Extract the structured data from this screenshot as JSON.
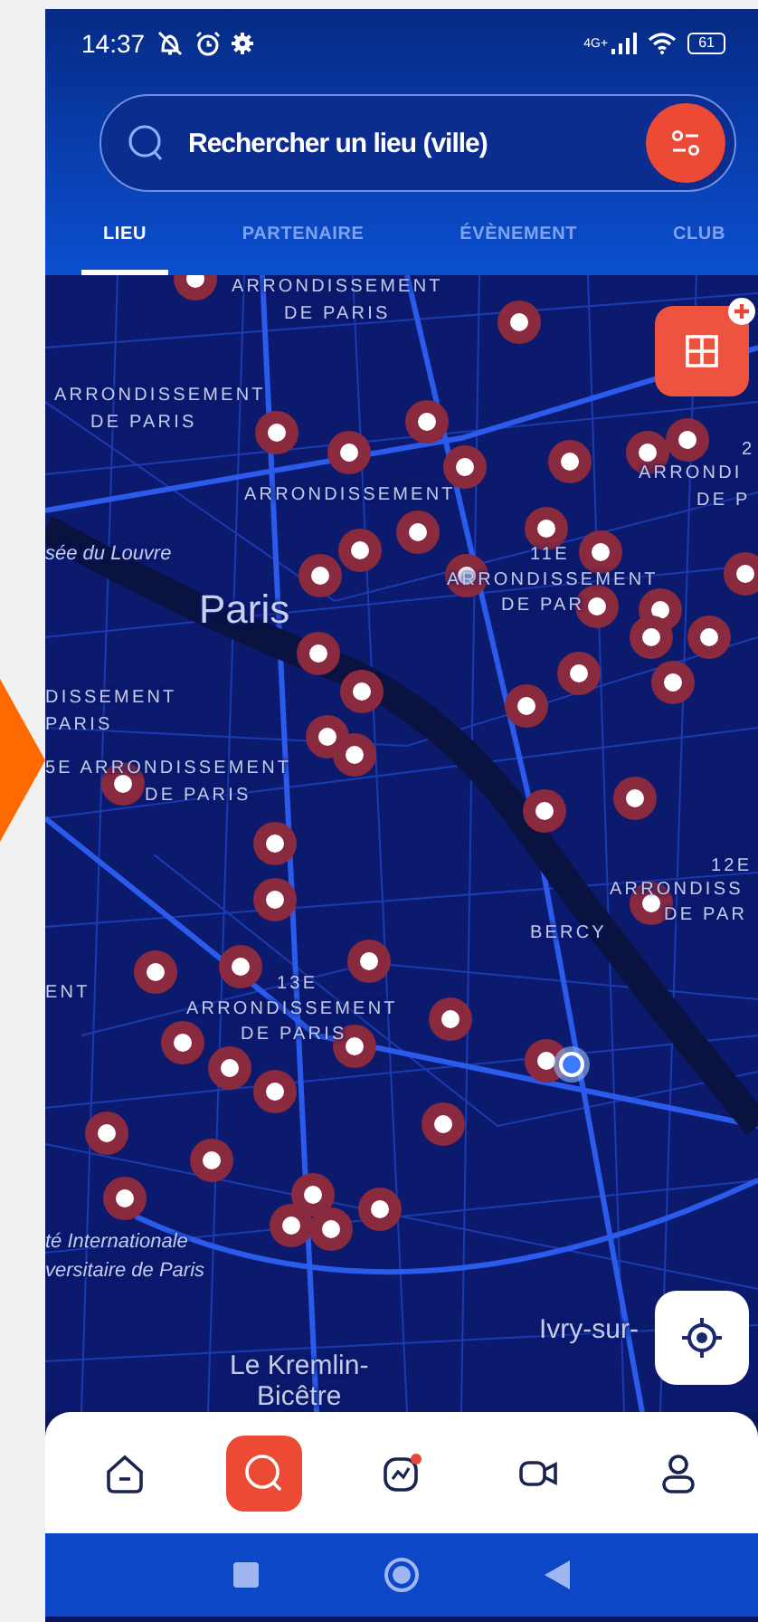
{
  "status_bar": {
    "time": "14:37",
    "network": "4G+",
    "battery": "61"
  },
  "search": {
    "placeholder": "Rechercher un lieu (ville)"
  },
  "tabs": [
    {
      "label": "LIEU",
      "selected": true
    },
    {
      "label": "PARTENAIRE",
      "selected": false
    },
    {
      "label": "ÉVÈNEMENT",
      "selected": false
    },
    {
      "label": "CLUB",
      "selected": false
    }
  ],
  "map": {
    "labels": [
      {
        "text": "ARRONDISSEMENT",
        "kind": "district"
      },
      {
        "text": "DE PARIS",
        "kind": "district"
      },
      {
        "text": "ARRONDISSEMENT",
        "kind": "district"
      },
      {
        "text": "DE PARIS",
        "kind": "district"
      },
      {
        "text": "ARRONDISSEMENT",
        "kind": "district"
      },
      {
        "text": "2",
        "kind": "district"
      },
      {
        "text": "ARRONDI",
        "kind": "district"
      },
      {
        "text": "DE P",
        "kind": "district"
      },
      {
        "text": "sée du Louvre",
        "kind": "poi"
      },
      {
        "text": "Paris",
        "kind": "city"
      },
      {
        "text": "11E",
        "kind": "district"
      },
      {
        "text": "ARRONDISSEMENT",
        "kind": "district"
      },
      {
        "text": "DE PAR",
        "kind": "district"
      },
      {
        "text": "DISSEMENT",
        "kind": "district"
      },
      {
        "text": "PARIS",
        "kind": "district"
      },
      {
        "text": "5E ARRONDISSEMENT",
        "kind": "district"
      },
      {
        "text": "DE PARIS",
        "kind": "district"
      },
      {
        "text": "12E",
        "kind": "district"
      },
      {
        "text": "ARRONDISS",
        "kind": "district"
      },
      {
        "text": "DE PAR",
        "kind": "district"
      },
      {
        "text": "BERCY",
        "kind": "district"
      },
      {
        "text": "ENT",
        "kind": "district"
      },
      {
        "text": "13E",
        "kind": "district"
      },
      {
        "text": "ARRONDISSEMENT",
        "kind": "district"
      },
      {
        "text": "DE PARIS",
        "kind": "district"
      },
      {
        "text": "té Internationale",
        "kind": "poi"
      },
      {
        "text": "versitaire de Paris",
        "kind": "poi"
      },
      {
        "text": "Ivry-sur-",
        "kind": "town"
      },
      {
        "text": "Le Kremlin-",
        "kind": "town"
      },
      {
        "text": "Bicêtre",
        "kind": "town"
      }
    ]
  },
  "bottom_nav": [
    {
      "kind": "home",
      "selected": false
    },
    {
      "kind": "search",
      "selected": true
    },
    {
      "kind": "stats",
      "selected": false
    },
    {
      "kind": "video",
      "selected": false
    },
    {
      "kind": "profile",
      "selected": false
    }
  ]
}
